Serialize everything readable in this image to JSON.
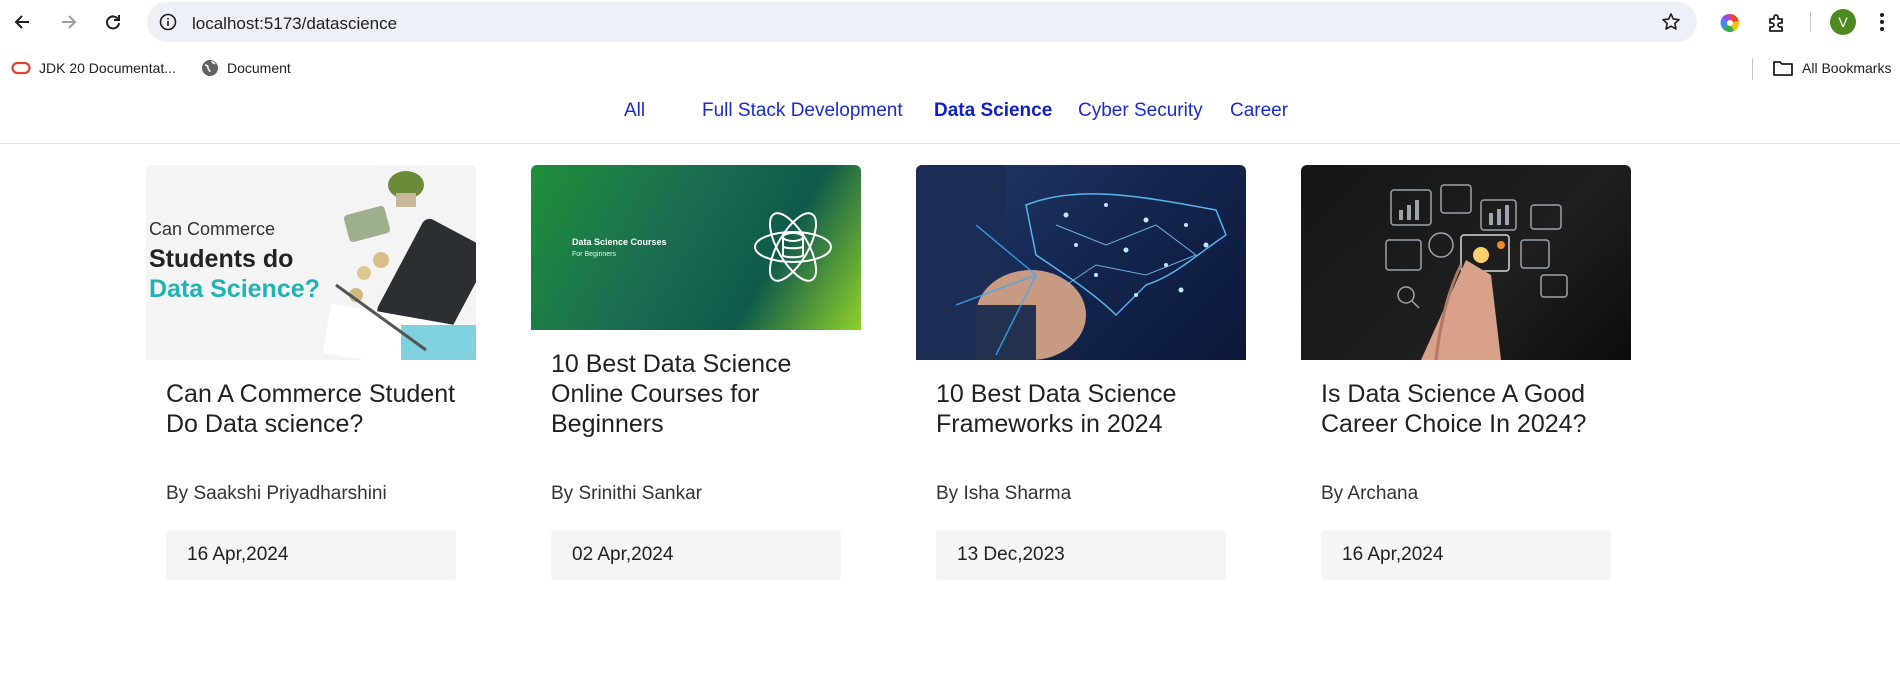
{
  "browser": {
    "url": "localhost:5173/datascience",
    "profile_initial": "V",
    "bookmarks": [
      {
        "label": "JDK 20 Documentat...",
        "icon": "oracle-icon"
      },
      {
        "label": "Document",
        "icon": "globe-icon"
      }
    ],
    "all_bookmarks_label": "All Bookmarks"
  },
  "nav": {
    "items": [
      {
        "label": "All",
        "active": false
      },
      {
        "label": "Full Stack Development",
        "active": false
      },
      {
        "label": "Data Science",
        "active": true
      },
      {
        "label": "Cyber Security",
        "active": false
      },
      {
        "label": "Career",
        "active": false
      }
    ]
  },
  "cards": [
    {
      "title": "Can A Commerce Student Do Data science?",
      "author": "By Saakshi Priyadharshini",
      "date": "16 Apr,2024",
      "image_text": {
        "line1": "Can Commerce",
        "line2": "Students do",
        "line3": "Data Science?"
      },
      "accent": "#1fb3b3"
    },
    {
      "title": "10 Best Data Science Online Courses for Beginners",
      "author": "By Srinithi Sankar",
      "date": "02 Apr,2024",
      "image_text": {
        "line1": "Data Science Courses",
        "line2": "For Beginners"
      },
      "accent": "#19a35a"
    },
    {
      "title": "10 Best Data Science Frameworks in 2024",
      "author": "By Isha Sharma",
      "date": "13 Dec,2023",
      "accent": "#2ea6ff"
    },
    {
      "title": "Is Data Science A Good Career Choice In 2024?",
      "author": "By Archana",
      "date": "16 Apr,2024",
      "accent": "#f08a24"
    }
  ],
  "colors": {
    "link": "#1a2bd6",
    "active_link": "#0f1fc9",
    "omnibox_bg": "#edf0f7",
    "date_bg": "#f5f5f5"
  }
}
